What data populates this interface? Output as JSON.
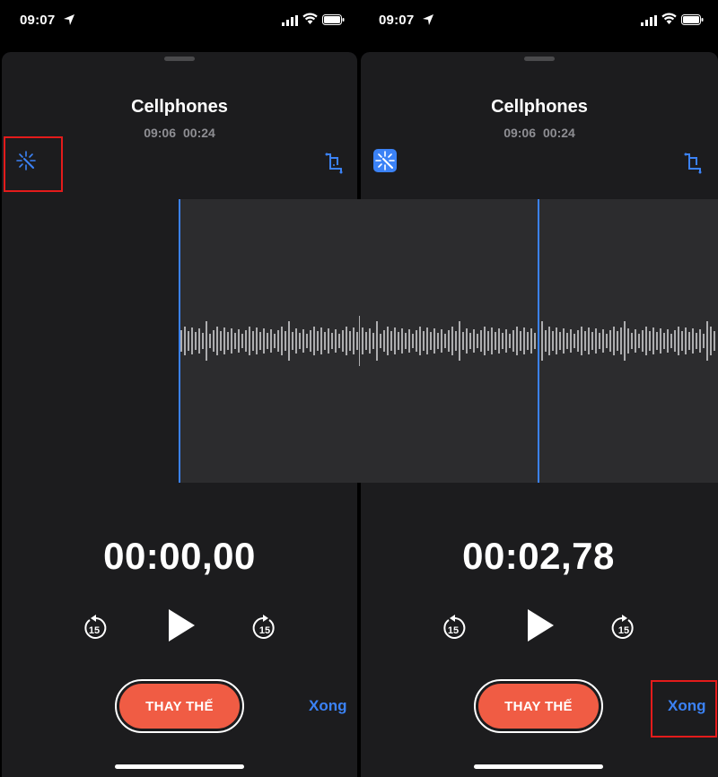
{
  "panels": [
    {
      "status": {
        "time": "09:07"
      },
      "recording": {
        "title": "Cellphones",
        "date_time": "09:06",
        "duration": "00:24"
      },
      "enhance_active": false,
      "playhead_time": "00:00,00",
      "controls": {
        "skip_back": "15",
        "skip_forward": "15"
      },
      "replace_label": "THAY THẾ",
      "done_label": "Xong"
    },
    {
      "status": {
        "time": "09:07"
      },
      "recording": {
        "title": "Cellphones",
        "date_time": "09:06",
        "duration": "00:24"
      },
      "enhance_active": true,
      "playhead_time": "00:02,78",
      "controls": {
        "skip_back": "15",
        "skip_forward": "15"
      },
      "replace_label": "THAY THẾ",
      "done_label": "Xong"
    }
  ],
  "colors": {
    "accent": "#3b82f6",
    "replace_button": "#f05c44",
    "highlight_box": "#e31b1b",
    "sheet_background": "#1c1c1e",
    "waveform_region": "#2c2c2e"
  },
  "icons": [
    "location-arrow-icon",
    "cellular-signal-icon",
    "wifi-icon",
    "battery-icon",
    "enhance-wand-icon",
    "trim-crop-icon",
    "skip-back-15-icon",
    "play-icon",
    "skip-forward-15-icon"
  ]
}
